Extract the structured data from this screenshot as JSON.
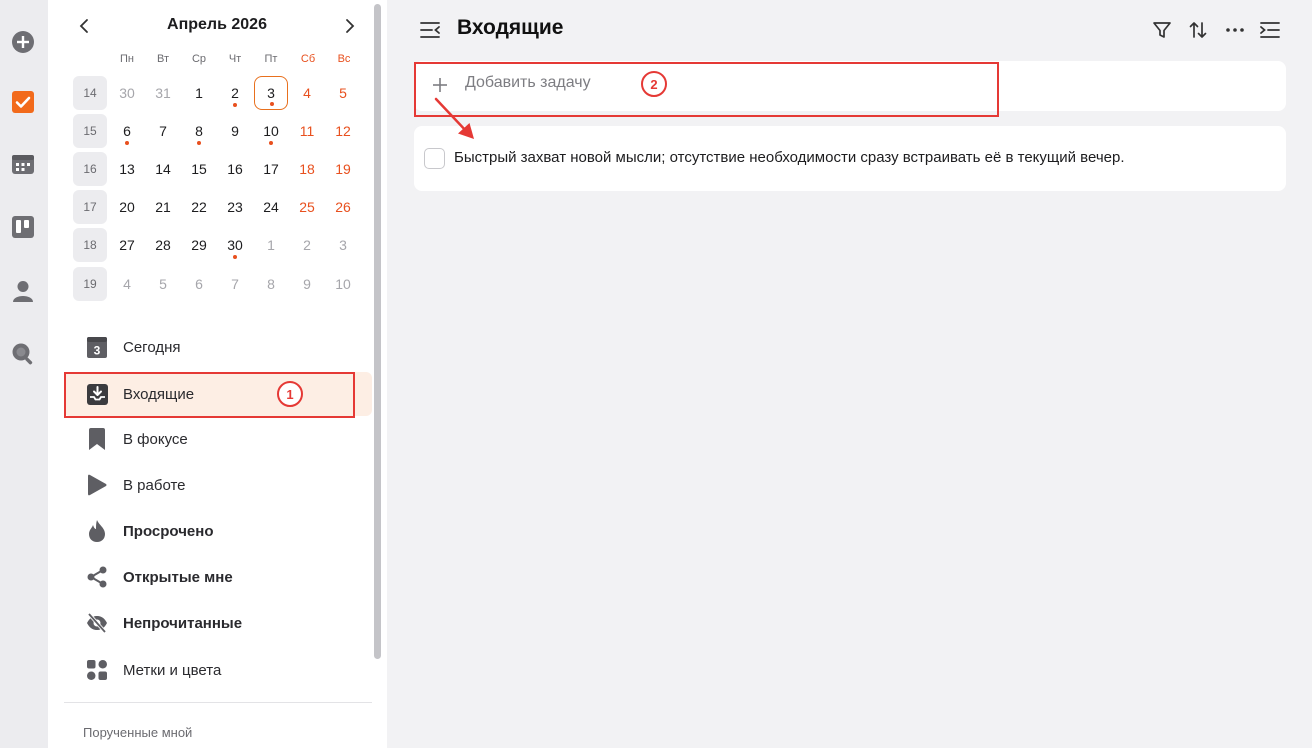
{
  "calendar": {
    "title": "Апрель 2026",
    "weekdays": [
      "Пн",
      "Вт",
      "Ср",
      "Чт",
      "Пт",
      "Сб",
      "Вс"
    ],
    "weeks": [
      {
        "num": "14",
        "days": [
          {
            "d": "30",
            "muted": true
          },
          {
            "d": "31",
            "muted": true
          },
          {
            "d": "1"
          },
          {
            "d": "2",
            "dot": true
          },
          {
            "d": "3",
            "today": true,
            "dot": true
          },
          {
            "d": "4",
            "we": true
          },
          {
            "d": "5",
            "we": true
          }
        ]
      },
      {
        "num": "15",
        "days": [
          {
            "d": "6",
            "dot": true
          },
          {
            "d": "7"
          },
          {
            "d": "8",
            "dot": true
          },
          {
            "d": "9"
          },
          {
            "d": "10",
            "dot": true
          },
          {
            "d": "11",
            "we": true
          },
          {
            "d": "12",
            "we": true
          }
        ]
      },
      {
        "num": "16",
        "days": [
          {
            "d": "13"
          },
          {
            "d": "14"
          },
          {
            "d": "15"
          },
          {
            "d": "16"
          },
          {
            "d": "17"
          },
          {
            "d": "18",
            "we": true
          },
          {
            "d": "19",
            "we": true
          }
        ]
      },
      {
        "num": "17",
        "days": [
          {
            "d": "20"
          },
          {
            "d": "21"
          },
          {
            "d": "22"
          },
          {
            "d": "23"
          },
          {
            "d": "24"
          },
          {
            "d": "25",
            "we": true
          },
          {
            "d": "26",
            "we": true
          }
        ]
      },
      {
        "num": "18",
        "days": [
          {
            "d": "27"
          },
          {
            "d": "28"
          },
          {
            "d": "29"
          },
          {
            "d": "30",
            "dot": true
          },
          {
            "d": "1",
            "muted": true
          },
          {
            "d": "2",
            "muted": true
          },
          {
            "d": "3",
            "muted": true
          }
        ]
      },
      {
        "num": "19",
        "days": [
          {
            "d": "4",
            "muted": true
          },
          {
            "d": "5",
            "muted": true
          },
          {
            "d": "6",
            "muted": true
          },
          {
            "d": "7",
            "muted": true
          },
          {
            "d": "8",
            "muted": true
          },
          {
            "d": "9",
            "muted": true
          },
          {
            "d": "10",
            "muted": true
          }
        ]
      }
    ]
  },
  "today_icon_number": "3",
  "nav": {
    "items": [
      {
        "label": "Сегодня",
        "icon": "calendar-today-icon"
      },
      {
        "label": "Входящие",
        "icon": "inbox-icon",
        "active": true
      },
      {
        "label": "В фокусе",
        "icon": "bookmark-icon"
      },
      {
        "label": "В работе",
        "icon": "play-icon"
      },
      {
        "label": "Просрочено",
        "icon": "flame-icon",
        "bold": true
      },
      {
        "label": "Открытые мне",
        "icon": "share-icon",
        "bold": true
      },
      {
        "label": "Непрочитанные",
        "icon": "eye-off-icon",
        "bold": true
      },
      {
        "label": "Метки и цвета",
        "icon": "tags-grid-icon"
      }
    ],
    "section_label": "Порученные мной"
  },
  "header": {
    "title": "Входящие"
  },
  "add_task": {
    "placeholder": "Добавить задачу"
  },
  "tasks": [
    {
      "text": "Быстрый захват новой мысли; отсутствие необходимости сразу встраивать её в текущий вечер.",
      "done": false
    }
  ],
  "annotations": {
    "badge1": "1",
    "badge2": "2"
  },
  "colors": {
    "accent": "#e8501e",
    "annotation": "#e53935",
    "active_bg": "#fdeee4"
  }
}
